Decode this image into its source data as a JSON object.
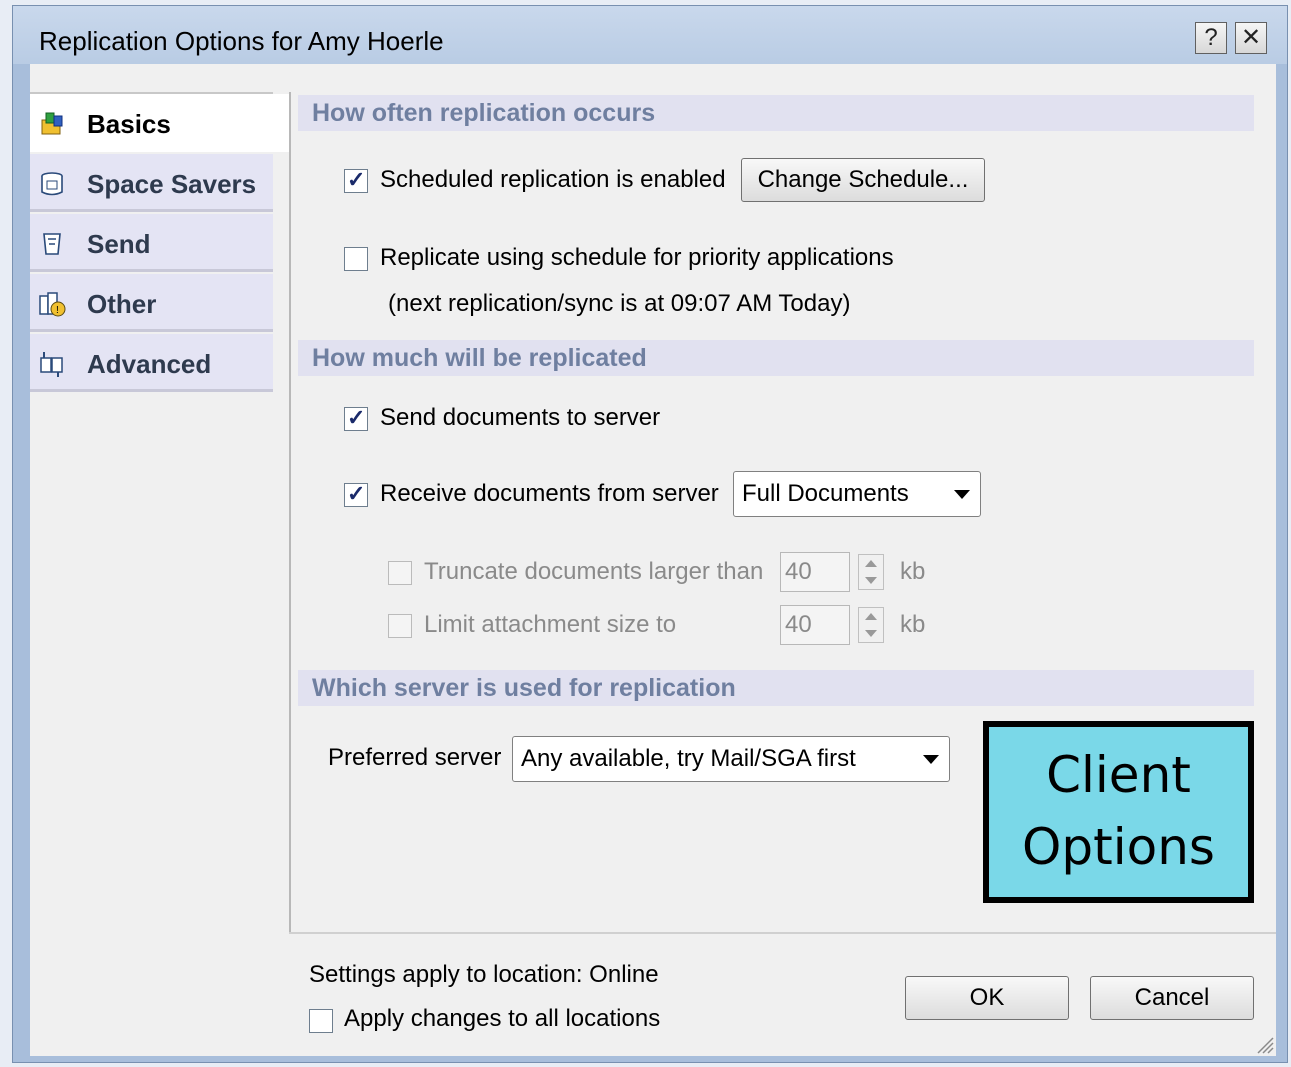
{
  "window": {
    "title": "Replication Options for Amy Hoerle",
    "help_label": "?",
    "close_label": "✕"
  },
  "sidebar": {
    "items": [
      {
        "label": "Basics",
        "icon": "basics-icon",
        "active": true
      },
      {
        "label": "Space Savers",
        "icon": "space-savers-icon"
      },
      {
        "label": "Send",
        "icon": "send-icon"
      },
      {
        "label": "Other",
        "icon": "other-icon"
      },
      {
        "label": "Advanced",
        "icon": "advanced-icon"
      }
    ]
  },
  "how_often": {
    "header": "How often replication occurs",
    "scheduled_label": "Scheduled replication is enabled",
    "scheduled_checked": true,
    "change_schedule_label": "Change Schedule...",
    "priority_label": "Replicate using schedule for priority applications",
    "priority_checked": false,
    "next_replication_text": "(next replication/sync is at 09:07 AM Today)"
  },
  "how_much": {
    "header": "How much will be replicated",
    "send_label": "Send documents to server",
    "send_checked": true,
    "receive_label": "Receive documents from server",
    "receive_checked": true,
    "receive_option": "Full Documents",
    "truncate_label": "Truncate documents larger than",
    "truncate_value": "40",
    "truncate_unit": "kb",
    "limit_label": "Limit attachment size to",
    "limit_value": "40",
    "limit_unit": "kb"
  },
  "which_server": {
    "header": "Which server is used for replication",
    "preferred_label": "Preferred server",
    "preferred_value": "Any available, try Mail/SGA first"
  },
  "footer": {
    "location_text": "Settings apply to location: Online",
    "apply_all_label": "Apply changes to all locations",
    "ok_label": "OK",
    "cancel_label": "Cancel"
  },
  "callout": {
    "line1": "Client",
    "line2": "Options",
    "color": "#7ad8e8"
  }
}
